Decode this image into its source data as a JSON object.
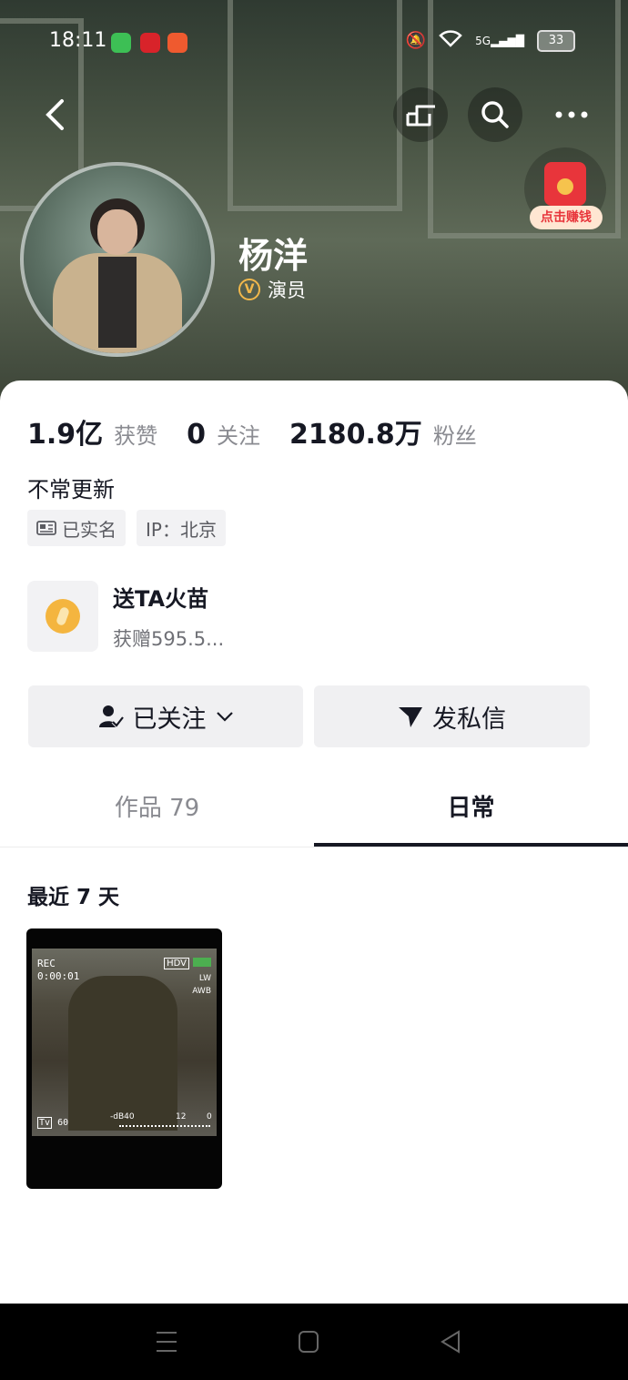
{
  "status_bar": {
    "time": "18:11",
    "battery": "33",
    "signal": "5G"
  },
  "header": {
    "profile": {
      "name": "杨洋",
      "role": "演员",
      "verified_badge": "V"
    },
    "red_packet_label": "点击赚钱"
  },
  "stats": [
    {
      "value": "1.9亿",
      "label": "获赞"
    },
    {
      "value": "0",
      "label": "关注"
    },
    {
      "value": "2180.8万",
      "label": "粉丝"
    }
  ],
  "bio": "不常更新",
  "tags": {
    "verified": "已实名",
    "ip": "IP：北京"
  },
  "gift": {
    "title": "送TA火苗",
    "subtitle": "获赠595.5..."
  },
  "buttons": {
    "follow": "已关注",
    "message": "发私信"
  },
  "tabs": [
    {
      "label": "作品 79",
      "active": false
    },
    {
      "label": "日常",
      "active": true
    }
  ],
  "section_title": "最近 7 天",
  "video_overlay": {
    "rec": "REC",
    "timecode": "0:00:01",
    "format": "HDV",
    "tv": "Tv",
    "tv_value": "60",
    "db": "-dB40",
    "db_mid": "12",
    "db_end": "0",
    "lw": "LW",
    "awb": "AWB"
  },
  "colors": {
    "accent": "#161823",
    "muted": "#8a8b91",
    "red": "#e8353b",
    "gold": "#f4b53f"
  }
}
